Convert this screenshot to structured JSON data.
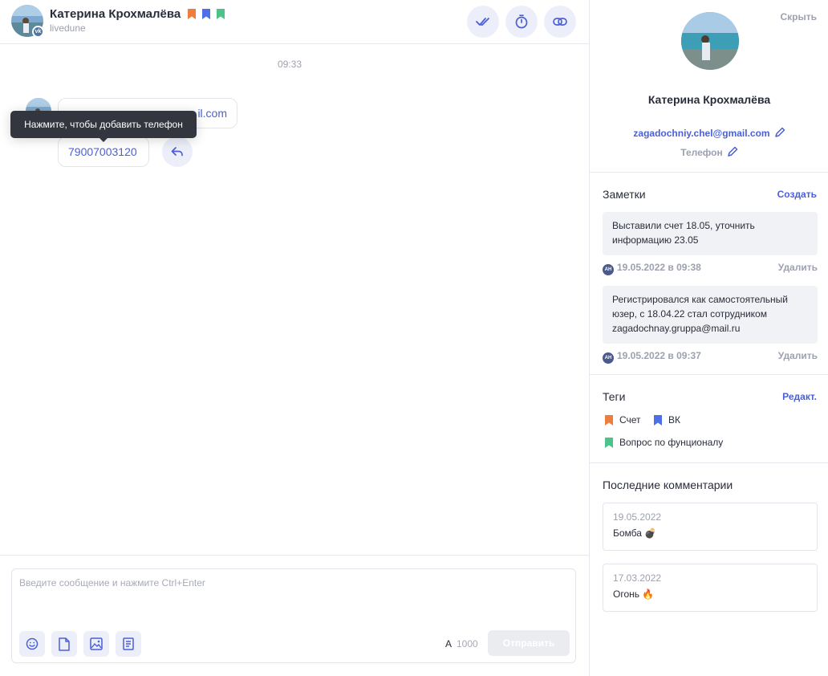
{
  "header": {
    "name": "Катерина Крохмалёва",
    "subtitle": "livedune",
    "network_badge": "vk",
    "tag_colors": [
      "#ef7d3c",
      "#4f6fe6",
      "#4dc38a"
    ],
    "buttons": [
      "double-check-icon",
      "timer-icon",
      "link-icon"
    ]
  },
  "messages": {
    "time": "09:33",
    "email": "zagadochniy.chel@gmail.com",
    "email_visible_tail": "il.com",
    "phone": "79007003120",
    "tooltip": "Нажмите, чтобы добавить телефон"
  },
  "composer": {
    "placeholder": "Введите сообщение и нажмите Ctrl+Enter",
    "tools": [
      "emoji-icon",
      "file-icon",
      "image-icon",
      "template-icon"
    ],
    "counter_label": "A",
    "counter_value": "1000",
    "send_label": "Отправить"
  },
  "profile": {
    "hide_label": "Скрыть",
    "name": "Катерина Крохмалёва",
    "email": "zagadochniy.chel@gmail.com",
    "phone_label": "Телефон"
  },
  "notes": {
    "title": "Заметки",
    "create_label": "Создать",
    "items": [
      {
        "text": "Выставили счет 18.05, уточнить информацию 23.05",
        "author": "АН",
        "date": "19.05.2022 в 09:38",
        "delete_label": "Удалить"
      },
      {
        "text": "Регистрировался как самостоятельный юзер, с 18.04.22 стал сотрудником zagadochnay.gruppa@mail.ru",
        "author": "АН",
        "date": "19.05.2022 в 09:37",
        "delete_label": "Удалить"
      }
    ]
  },
  "tags": {
    "title": "Теги",
    "edit_label": "Редакт.",
    "items": [
      {
        "label": "Счет",
        "color": "#ef7d3c"
      },
      {
        "label": "ВК",
        "color": "#4f6fe6"
      },
      {
        "label": "Вопрос по фунционалу",
        "color": "#4dc38a"
      }
    ]
  },
  "comments": {
    "title": "Последние комментарии",
    "items": [
      {
        "date": "19.05.2022",
        "text": "Бомба",
        "emoji": "💣"
      },
      {
        "date": "17.03.2022",
        "text": "Огонь",
        "emoji": "🔥"
      }
    ]
  },
  "colors": {
    "accent": "#4b5fd6",
    "muted": "#9da1b0",
    "icon_bg": "#eceef9"
  }
}
